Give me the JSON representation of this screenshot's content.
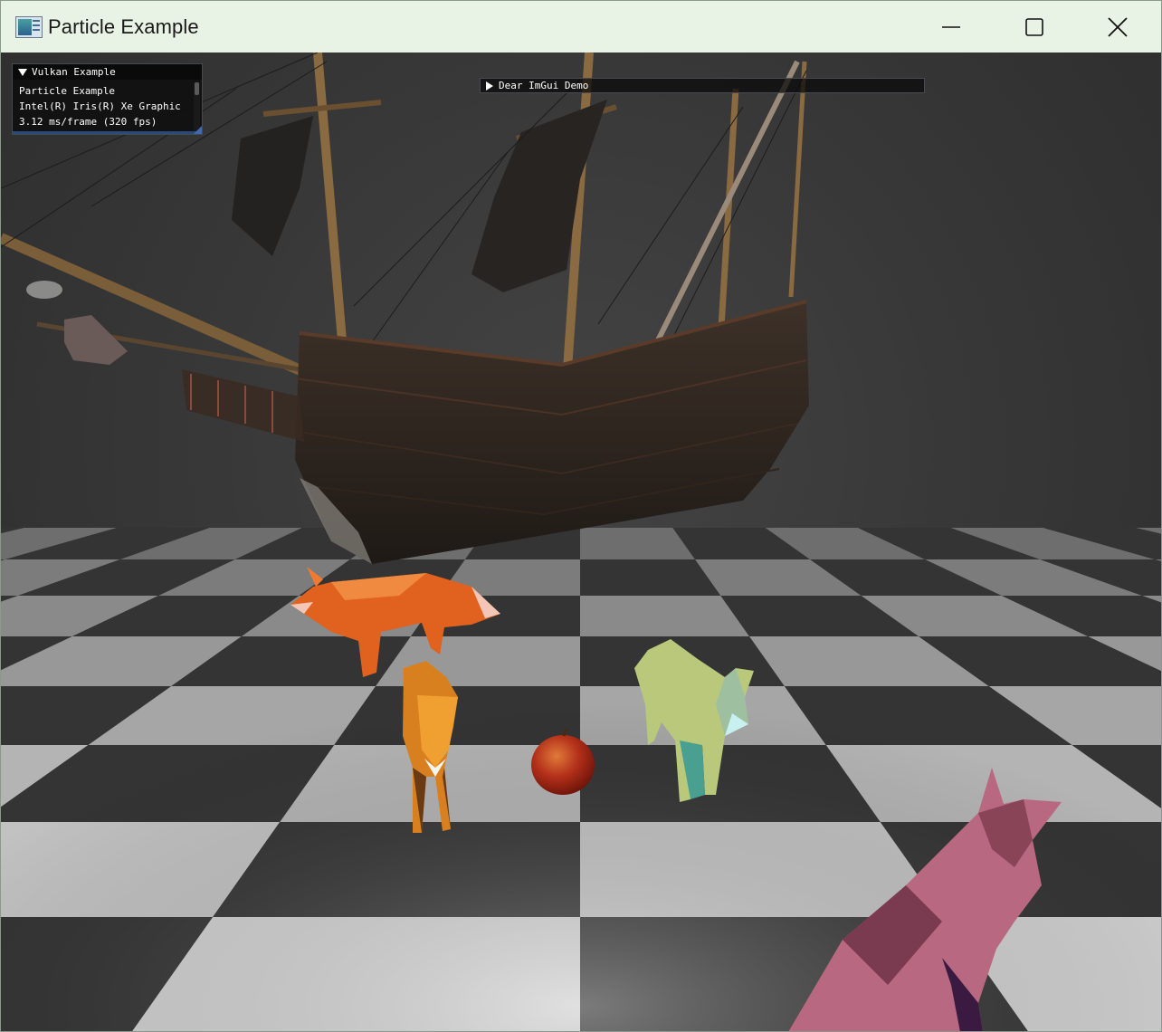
{
  "window": {
    "title": "Particle Example",
    "controls": {
      "minimize_icon": "minimize-icon",
      "maximize_icon": "maximize-icon",
      "close_icon": "close-icon"
    }
  },
  "imgui": {
    "vulkan_panel": {
      "title": "Vulkan Example",
      "lines": [
        "Particle Example",
        "Intel(R) Iris(R) Xe Graphic",
        "3.12 ms/frame (320 fps)"
      ],
      "collapsed": false
    },
    "demo_panel": {
      "title": "Dear ImGui Demo",
      "collapsed": true
    }
  },
  "scene": {
    "background": "#3a3a3a",
    "floor": "checkerboard",
    "objects": [
      "sailing-ship",
      "red-fox",
      "orange-fox",
      "apple",
      "green-wolf",
      "pink-wolf"
    ]
  },
  "colors": {
    "titlebar": "#e9f3e5",
    "imgui_bg": "#0f0f0f",
    "imgui_accent": "#3d6ab0"
  }
}
